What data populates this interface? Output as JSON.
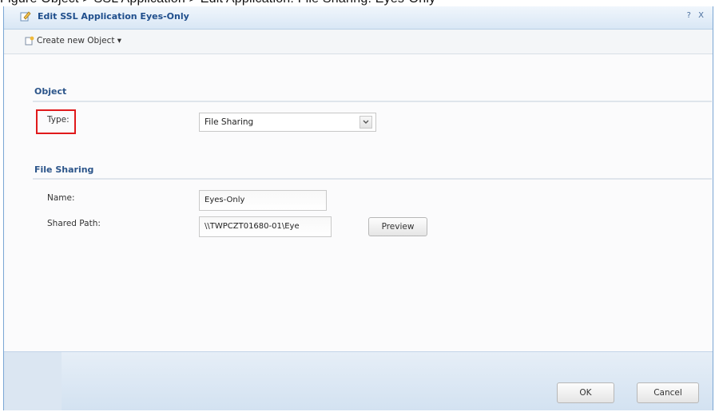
{
  "caption": {
    "text": "Figure   Object > SSL Application > Edit Application: File Sharing: Eyes-Only"
  },
  "dialog": {
    "title": "Edit SSL Application Eyes-Only",
    "controls": "? X"
  },
  "toolbar": {
    "create_label": "Create new Object ▾"
  },
  "object_section": {
    "title": "Object",
    "type_label": "Type:",
    "type_value": "File Sharing"
  },
  "file_sharing_section": {
    "title": "File Sharing",
    "name_label": "Name:",
    "name_value": "Eyes-Only",
    "shared_path_label": "Shared Path:",
    "shared_path_value": "\\\\TWPCZT01680-01\\Eye",
    "preview_label": "Preview"
  },
  "footer": {
    "ok_label": "OK",
    "cancel_label": "Cancel"
  },
  "icons": {
    "title": "edit-icon",
    "create": "new-object-icon",
    "dropdown": "chevron-down-icon"
  },
  "colors": {
    "title_text": "#1f4e8c",
    "highlight": "#e0191b",
    "section_text": "#2c558a"
  }
}
